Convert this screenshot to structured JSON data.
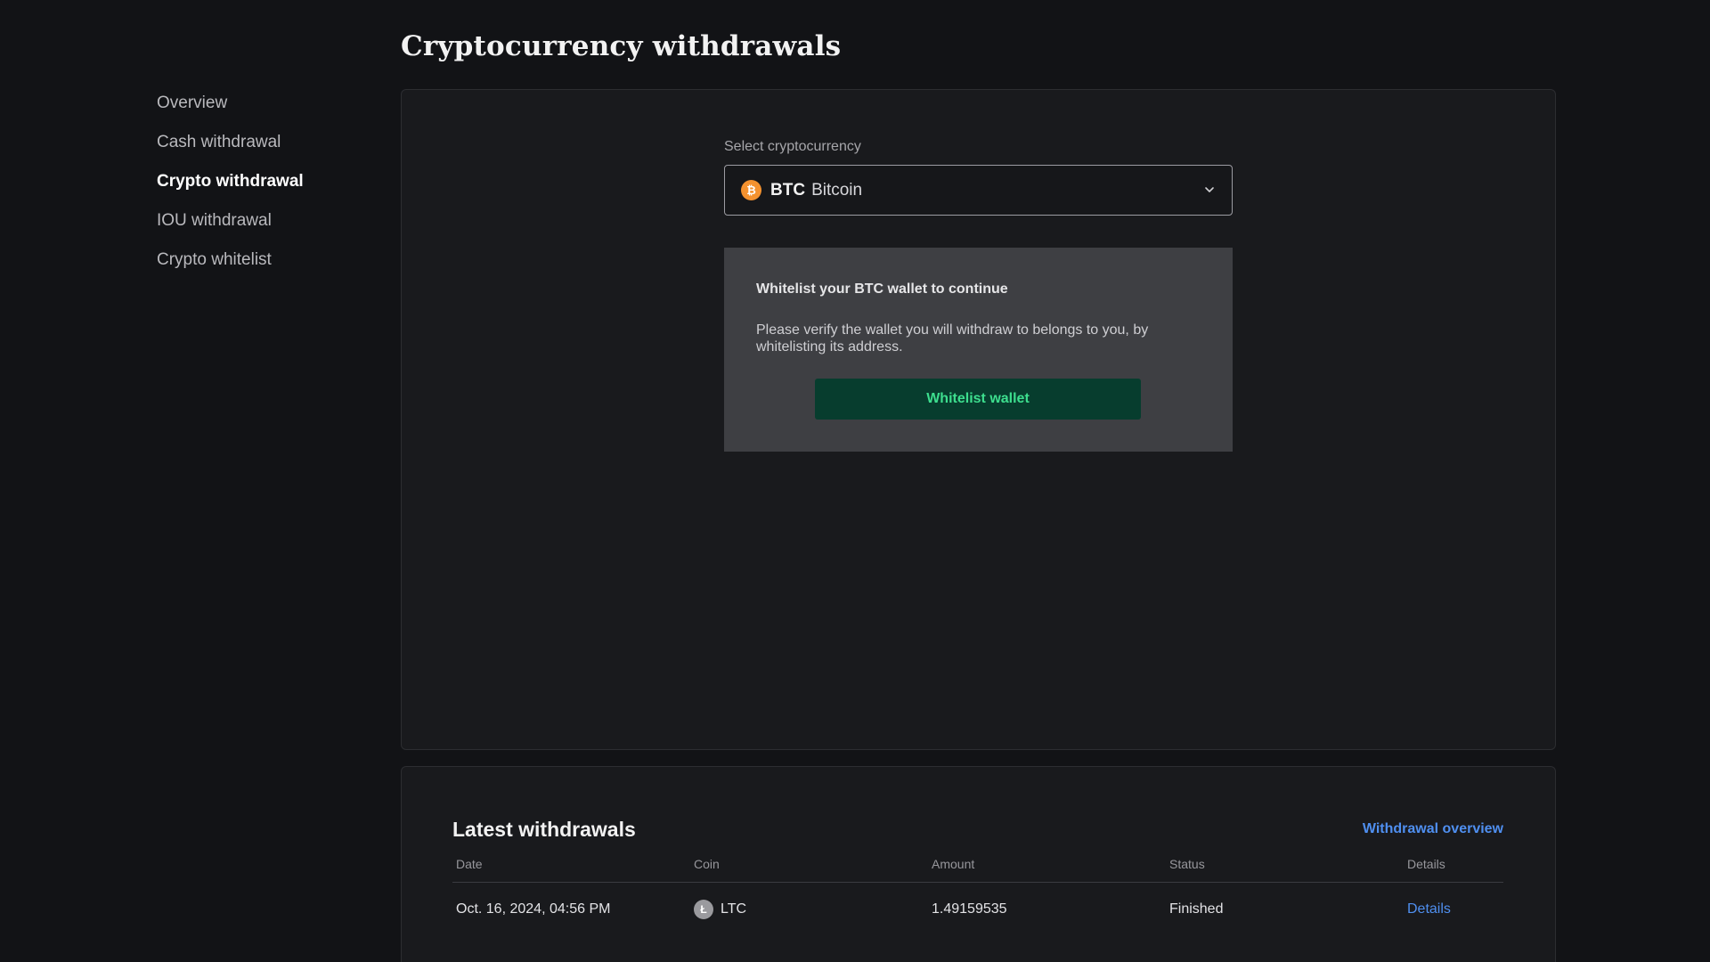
{
  "sidebar": {
    "items": [
      {
        "label": "Overview",
        "active": false
      },
      {
        "label": "Cash withdrawal",
        "active": false
      },
      {
        "label": "Crypto withdrawal",
        "active": true
      },
      {
        "label": "IOU withdrawal",
        "active": false
      },
      {
        "label": "Crypto whitelist",
        "active": false
      }
    ]
  },
  "page": {
    "title": "Cryptocurrency withdrawals"
  },
  "select": {
    "label": "Select cryptocurrency",
    "icon": "bitcoin-icon",
    "icon_glyph": "₿",
    "code": "BTC",
    "name": "Bitcoin"
  },
  "whitelist": {
    "title": "Whitelist your BTC wallet to continue",
    "text": "Please verify the wallet you will withdraw to belongs to you, by whitelisting its address.",
    "button_label": "Whitelist wallet"
  },
  "latest": {
    "title": "Latest withdrawals",
    "overview_link": "Withdrawal overview",
    "columns": [
      "Date",
      "Coin",
      "Amount",
      "Status",
      "Details"
    ],
    "rows": [
      {
        "date": "Oct. 16, 2024, 04:56 PM",
        "coin_icon": "litecoin-icon",
        "coin_glyph": "Ł",
        "coin": "LTC",
        "amount": "1.49159535",
        "status": "Finished",
        "details": "Details"
      }
    ]
  },
  "colors": {
    "background": "#121316",
    "panel": "#191a1d",
    "accent_green": "#3dde8e",
    "link_blue": "#4f8ff0",
    "btc_orange": "#f4922f"
  }
}
